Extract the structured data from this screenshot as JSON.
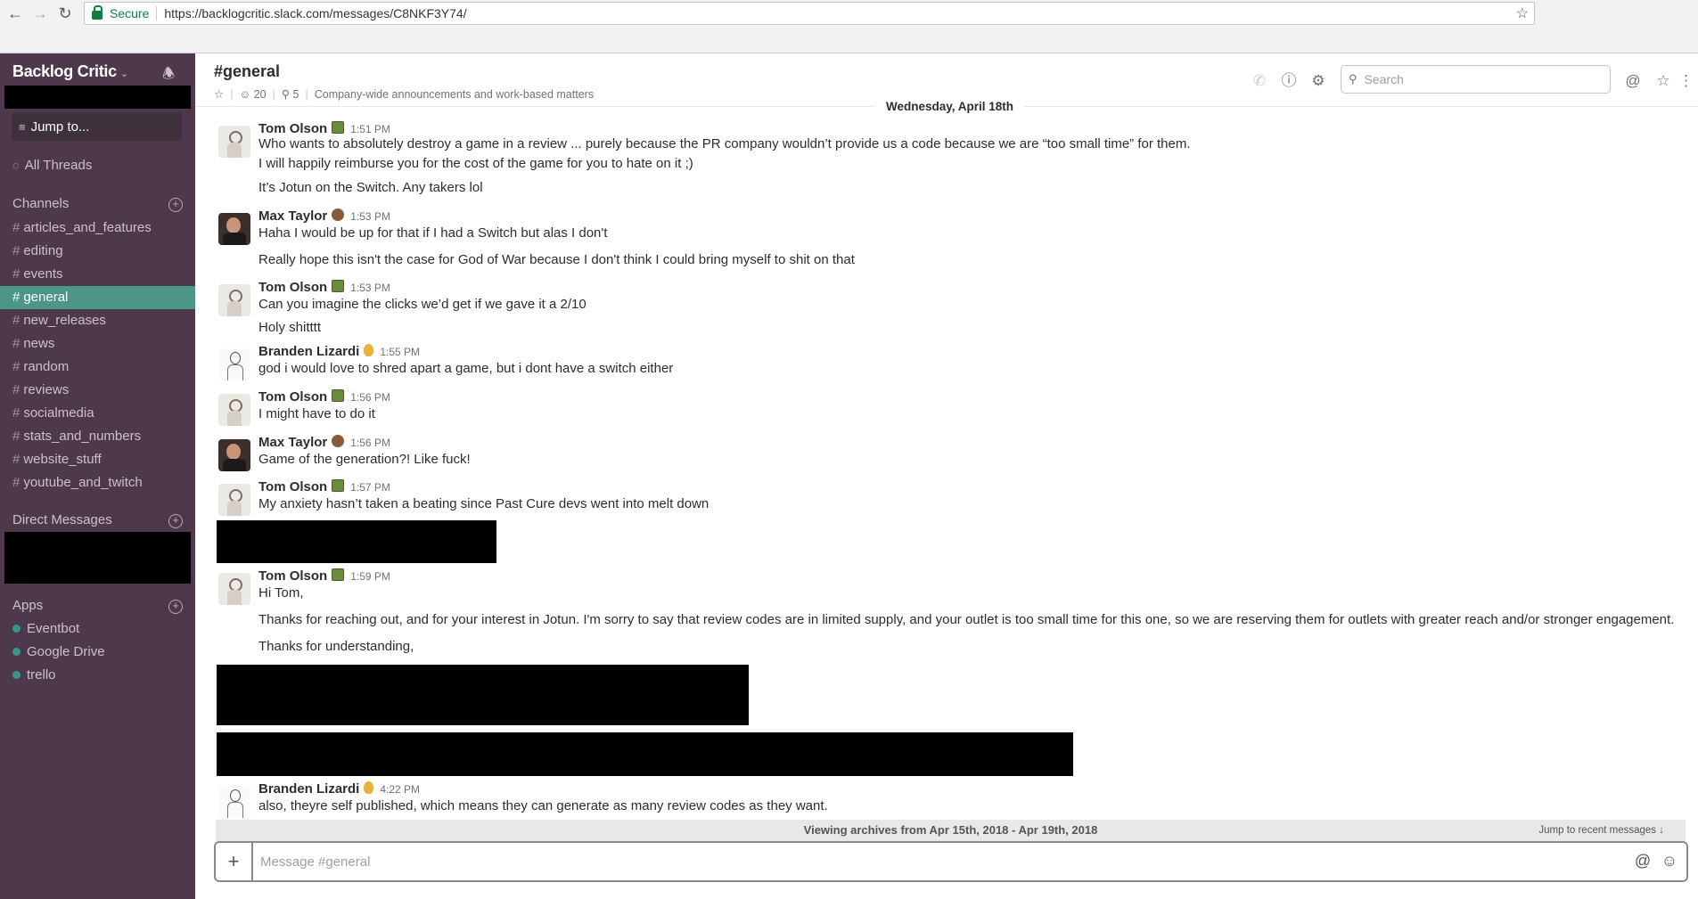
{
  "browser": {
    "secure_label": "Secure",
    "url": "https://backlogcritic.slack.com/messages/C8NKF3Y74/"
  },
  "sidebar": {
    "team_name": "Backlog Critic",
    "jump_label": "Jump to...",
    "threads_label": "All Threads",
    "channels_header": "Channels",
    "channels": [
      {
        "name": "articles_and_features",
        "active": false
      },
      {
        "name": "editing",
        "active": false
      },
      {
        "name": "events",
        "active": false
      },
      {
        "name": "general",
        "active": true
      },
      {
        "name": "new_releases",
        "active": false
      },
      {
        "name": "news",
        "active": false
      },
      {
        "name": "random",
        "active": false
      },
      {
        "name": "reviews",
        "active": false
      },
      {
        "name": "socialmedia",
        "active": false
      },
      {
        "name": "stats_and_numbers",
        "active": false
      },
      {
        "name": "website_stuff",
        "active": false
      },
      {
        "name": "youtube_and_twitch",
        "active": false
      }
    ],
    "dm_header": "Direct Messages",
    "apps_header": "Apps",
    "apps": [
      "Eventbot",
      "Google Drive",
      "trello"
    ]
  },
  "channel": {
    "title": "#general",
    "members": "20",
    "pins": "5",
    "topic": "Company-wide announcements and work-based matters",
    "search_placeholder": "Search"
  },
  "day_divider": "Wednesday, April 18th",
  "messages": [
    {
      "author": "Tom Olson",
      "time": "1:51 PM",
      "lines": [
        "Who wants to absolutely destroy a game in a review ... purely because the PR company wouldn’t provide us a code because we are “too small time” for them.",
        "I will happily reimburse you for the cost of the game for you to hate on it ;)",
        "It’s Jotun on the Switch. Any takers lol"
      ]
    },
    {
      "author": "Max Taylor",
      "time": "1:53 PM",
      "lines": [
        "Haha I would be up for that if I had a Switch but alas I don't",
        "Really hope this isn't the case for God of War because I don't think I could bring myself to shit on that"
      ]
    },
    {
      "author": "Tom Olson",
      "time": "1:53 PM",
      "lines": [
        "Can you imagine the clicks we’d get if we gave it a 2/10",
        "Holy shitttt"
      ]
    },
    {
      "author": "Branden Lizardi",
      "time": "1:55 PM",
      "lines": [
        "god i would love to shred apart a game, but i dont have a switch either"
      ]
    },
    {
      "author": "Tom Olson",
      "time": "1:56 PM",
      "lines": [
        "I might have to do it"
      ]
    },
    {
      "author": "Max Taylor",
      "time": "1:56 PM",
      "lines": [
        "Game of the generation?! Like fuck!"
      ]
    },
    {
      "author": "Tom Olson",
      "time": "1:57 PM",
      "lines": [
        "My anxiety hasn’t taken a beating since Past Cure devs went into melt down"
      ]
    },
    {
      "author": "Tom Olson",
      "time": "1:59 PM",
      "lines": [
        "Hi Tom,",
        "Thanks for reaching out, and for your interest in Jotun. I'm sorry to say that review codes are in limited supply, and your outlet is too small time for this one, so we are reserving them for outlets with greater reach and/or stronger engagement.",
        "Thanks for understanding,"
      ]
    },
    {
      "author": "Branden Lizardi",
      "time": "4:22 PM",
      "lines": [
        "also, theyre self published, which means they can generate as many review codes as they want."
      ]
    }
  ],
  "archive_bar": {
    "text": "Viewing archives from Apr 15th, 2018 - Apr 19th, 2018",
    "jump_recent": "Jump to recent messages ↓"
  },
  "composer": {
    "placeholder": "Message #general"
  }
}
